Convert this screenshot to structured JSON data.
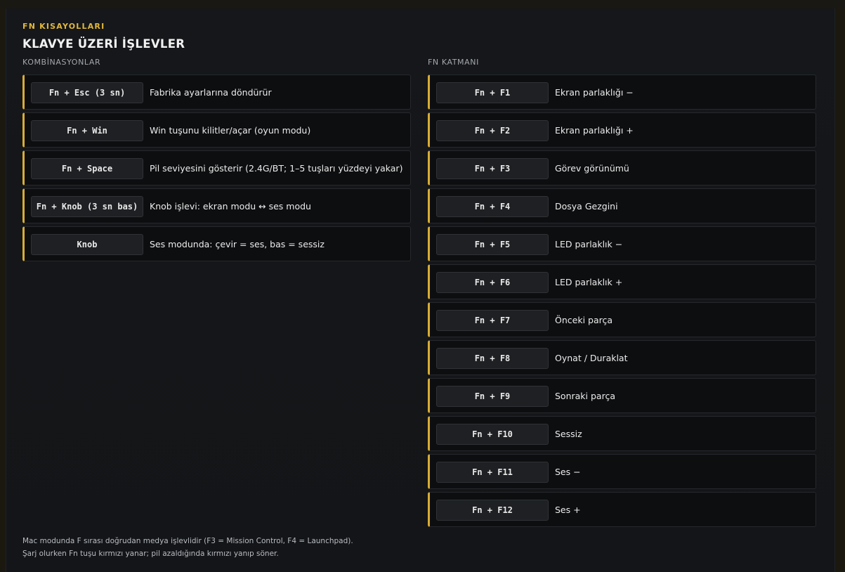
{
  "header": {
    "eyebrow": "FN KISAYOLLARI",
    "title": "KLAVYE ÜZERİ İŞLEVLER"
  },
  "left": {
    "label": "KOMBİNASYONLAR",
    "items": [
      {
        "key": "Fn + Esc (3 sn)",
        "desc": "Fabrika ayarlarına döndürür"
      },
      {
        "key": "Fn + Win",
        "desc": "Win tuşunu kilitler/açar (oyun modu)"
      },
      {
        "key": "Fn + Space",
        "desc": "Pil seviyesini gösterir (2.4G/BT; 1–5 tuşları yüzdeyi yakar)"
      },
      {
        "key": "Fn + Knob (3 sn bas)",
        "desc": "Knob işlevi: ekran modu ↔ ses modu"
      },
      {
        "key": "Knob",
        "desc": "Ses modunda: çevir = ses, bas = sessiz"
      }
    ]
  },
  "right": {
    "label": "FN KATMANI",
    "items": [
      {
        "key": "Fn + F1",
        "desc": "Ekran parlaklığı −"
      },
      {
        "key": "Fn + F2",
        "desc": "Ekran parlaklığı +"
      },
      {
        "key": "Fn + F3",
        "desc": "Görev görünümü"
      },
      {
        "key": "Fn + F4",
        "desc": "Dosya Gezgini"
      },
      {
        "key": "Fn + F5",
        "desc": "LED parlaklık −"
      },
      {
        "key": "Fn + F6",
        "desc": "LED parlaklık +"
      },
      {
        "key": "Fn + F7",
        "desc": "Önceki parça"
      },
      {
        "key": "Fn + F8",
        "desc": "Oynat / Duraklat"
      },
      {
        "key": "Fn + F9",
        "desc": "Sonraki parça"
      },
      {
        "key": "Fn + F10",
        "desc": "Sessiz"
      },
      {
        "key": "Fn + F11",
        "desc": "Ses −"
      },
      {
        "key": "Fn + F12",
        "desc": "Ses +"
      }
    ]
  },
  "footer": {
    "line1": "Mac modunda F sırası doğrudan medya işlevlidir (F3 = Mission Control, F4 = Launchpad).",
    "line2": "Şarj olurken Fn tuşu kırmızı yanar; pil azaldığında kırmızı yanıp söner."
  },
  "colors": {
    "accent": "#e2b73c",
    "row_accent": "#d9ad34",
    "row_bg": "#0d0e10",
    "panel_bg": "#15171a"
  }
}
